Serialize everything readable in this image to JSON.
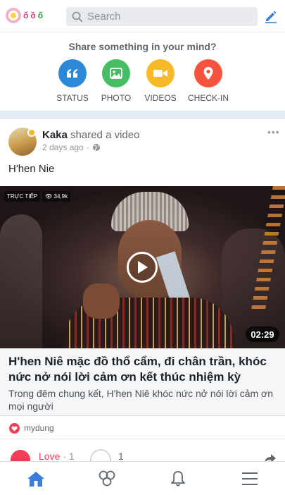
{
  "logo": {
    "text_1": "ố",
    "text_2": "ồ",
    "text_3": "ố"
  },
  "search": {
    "placeholder": "Search"
  },
  "share": {
    "title": "Share something in your mind?",
    "options": [
      {
        "label": "STATUS",
        "color": "#2d88d8",
        "icon": "quote-icon"
      },
      {
        "label": "PHOTO",
        "color": "#45bd62",
        "icon": "photo-icon"
      },
      {
        "label": "VIDEOS",
        "color": "#f7b928",
        "icon": "video-camera-icon"
      },
      {
        "label": "CHECK-IN",
        "color": "#f5533d",
        "icon": "location-pin-icon"
      }
    ]
  },
  "post": {
    "author": "Kaka",
    "action": "shared a video",
    "time": "2 days ago",
    "separator": "·",
    "text": "H'hen Nie",
    "more": "•••",
    "video": {
      "live_tag": "TRỰC TIẾP",
      "views": "34,9k",
      "duration": "02:29"
    },
    "link": {
      "title": "H'hen Niê mặc đồ thổ cẩm, đi chân trần, khóc nức nở nói lời cảm ơn kết thúc nhiệm kỳ",
      "description": "Trong đêm chung kết, H'hen Niê khóc nức nở nói lời cảm ơn mọi người"
    },
    "reactions": {
      "reactor": "mydung"
    },
    "actions": {
      "love_label": "Love",
      "love_count": "1",
      "comment_count": "1",
      "dot": "·"
    }
  },
  "colors": {
    "accent": "#3b7ddd",
    "love": "#f33e58",
    "separator": "#e4ebf5"
  }
}
